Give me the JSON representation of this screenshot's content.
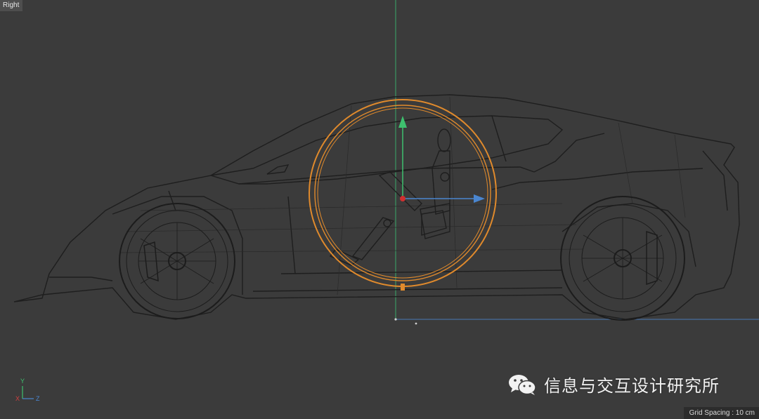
{
  "viewport": {
    "view_name": "Right",
    "grid_spacing": "Grid Spacing : 10 cm",
    "background_color": "#3b3b3b",
    "selection_color": "#e08a2c"
  },
  "axis_gizmo": {
    "y_label": "Y",
    "x_label": "X",
    "z_label": "Z"
  },
  "watermark": {
    "text": "信息与交互设计研究所",
    "icon": "wechat-icon"
  }
}
